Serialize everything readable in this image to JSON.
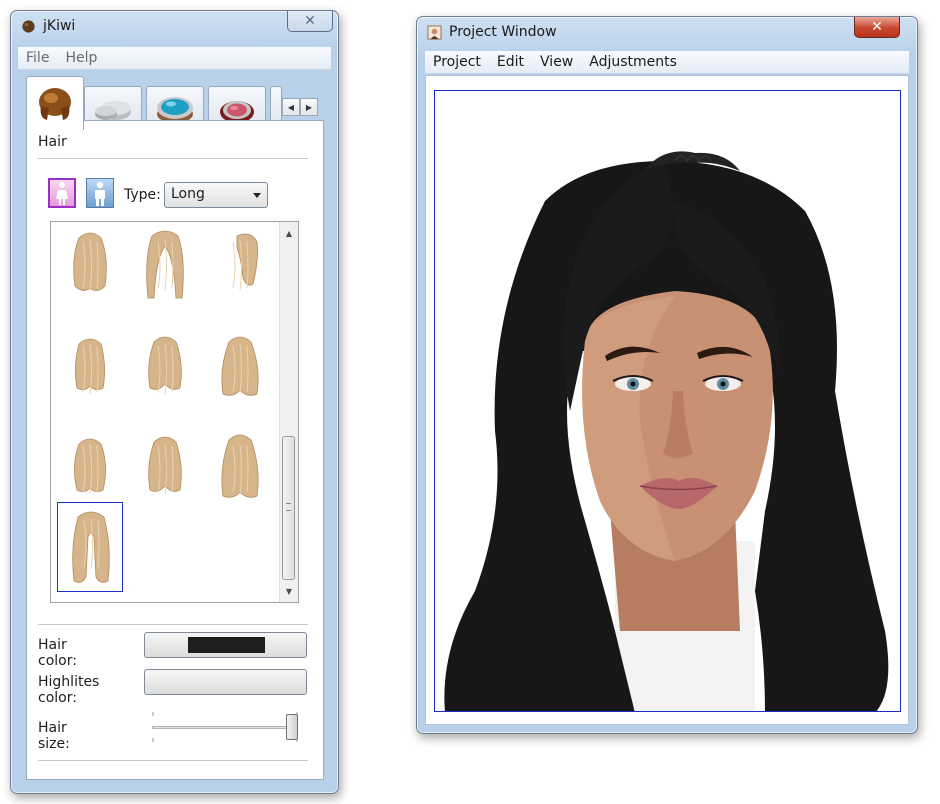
{
  "kiwi_window": {
    "title": "jKiwi",
    "close_glyph": "✕",
    "menu": [
      "File",
      "Help"
    ],
    "tabs": [
      {
        "icon": "hair-tab-icon",
        "selected": true
      },
      {
        "icon": "foundation-tab-icon",
        "selected": false
      },
      {
        "icon": "eyeshadow-tab-icon",
        "selected": false
      },
      {
        "icon": "blush-tab-icon",
        "selected": false
      }
    ],
    "section_title": "Hair",
    "gender": {
      "selected": "female"
    },
    "type_label": "Type:",
    "type_value": "Long",
    "hairstyles_count_visible": 10,
    "selected_hairstyle_index": 9,
    "hair_color_label": "Hair color:",
    "hair_color_value": "#1e1e1e",
    "highlights_color_label": "Highlites color:",
    "hair_size_label": "Hair size:",
    "hair_size_level": 1.0
  },
  "project_window": {
    "title": "Project Window",
    "close_glyph": "✕",
    "menu": [
      "Project",
      "Edit",
      "View",
      "Adjustments"
    ]
  },
  "colors": {
    "hair_blonde": "#d7b58a",
    "hair_dark": "#171717",
    "skin": "#c99173",
    "selection_blue": "#1a2fd0",
    "close_red": "#c9482f"
  }
}
